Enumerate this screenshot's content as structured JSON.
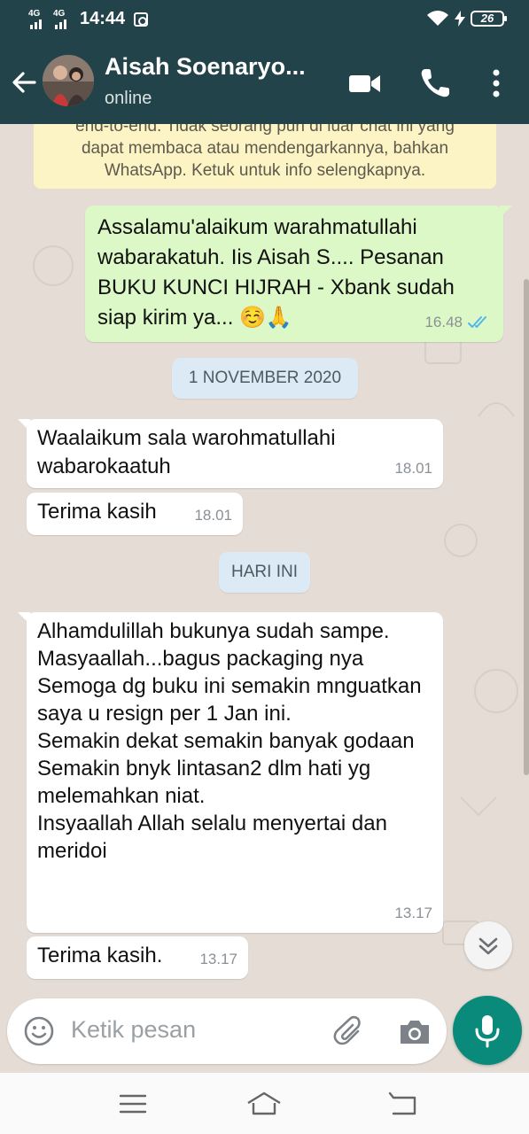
{
  "status_bar": {
    "network1": "4G",
    "network2": "4G",
    "time": "14:44",
    "battery": "26"
  },
  "header": {
    "contact_name": "Aisah Soenaryo...",
    "status": "online"
  },
  "encryption_notice": {
    "line1": "end-to-end. Tidak seorang pun di luar chat ini yang",
    "line2": "dapat membaca atau mendengarkannya, bahkan",
    "line3": "WhatsApp. Ketuk untuk info selengkapnya."
  },
  "messages": [
    {
      "direction": "out",
      "text": "Assalamu'alaikum warahmatullahi wabarakatuh. Iis Aisah S.... Pesanan BUKU KUNCI HIJRAH - Xbank sudah siap kirim ya... ☺️🙏",
      "time": "16.48",
      "read": true
    },
    {
      "direction": "in",
      "text": "Waalaikum sala warohmatullahi wabarokaatuh",
      "time": "18.01"
    },
    {
      "direction": "in",
      "text": "Terima kasih",
      "time": "18.01"
    },
    {
      "direction": "in",
      "text": "Alhamdulillah bukunya sudah sampe.\nMasyaallah...bagus packaging nya\nSemoga dg buku ini semakin mnguatkan saya u resign per 1 Jan ini.\nSemakin dekat semakin banyak godaan\nSemakin bnyk lintasan2 dlm hati yg melemahkan niat.\nInsyaallah Allah selalu menyertai dan meridoi",
      "time": "13.17"
    },
    {
      "direction": "in",
      "text": "Terima kasih.",
      "time": "13.17"
    }
  ],
  "date_chips": {
    "first": "1 NOVEMBER 2020",
    "second": "HARI INI"
  },
  "composer": {
    "placeholder": "Ketik pesan"
  },
  "colors": {
    "header_bg": "#23434a",
    "outgoing_bubble": "#dcf8c6",
    "incoming_bubble": "#ffffff",
    "chat_bg": "#e5ddd5",
    "notice_bg": "#fdf4c5",
    "mic_button": "#0a8a7a",
    "read_ticks": "#4fb6ec"
  },
  "icons": {
    "back": "arrow-left-icon",
    "video": "video-call-icon",
    "call": "phone-icon",
    "menu": "more-vert-icon",
    "emoji": "emoji-icon",
    "attach": "paperclip-icon",
    "camera": "camera-icon",
    "mic": "mic-icon",
    "scroll": "chevron-double-down-icon"
  }
}
